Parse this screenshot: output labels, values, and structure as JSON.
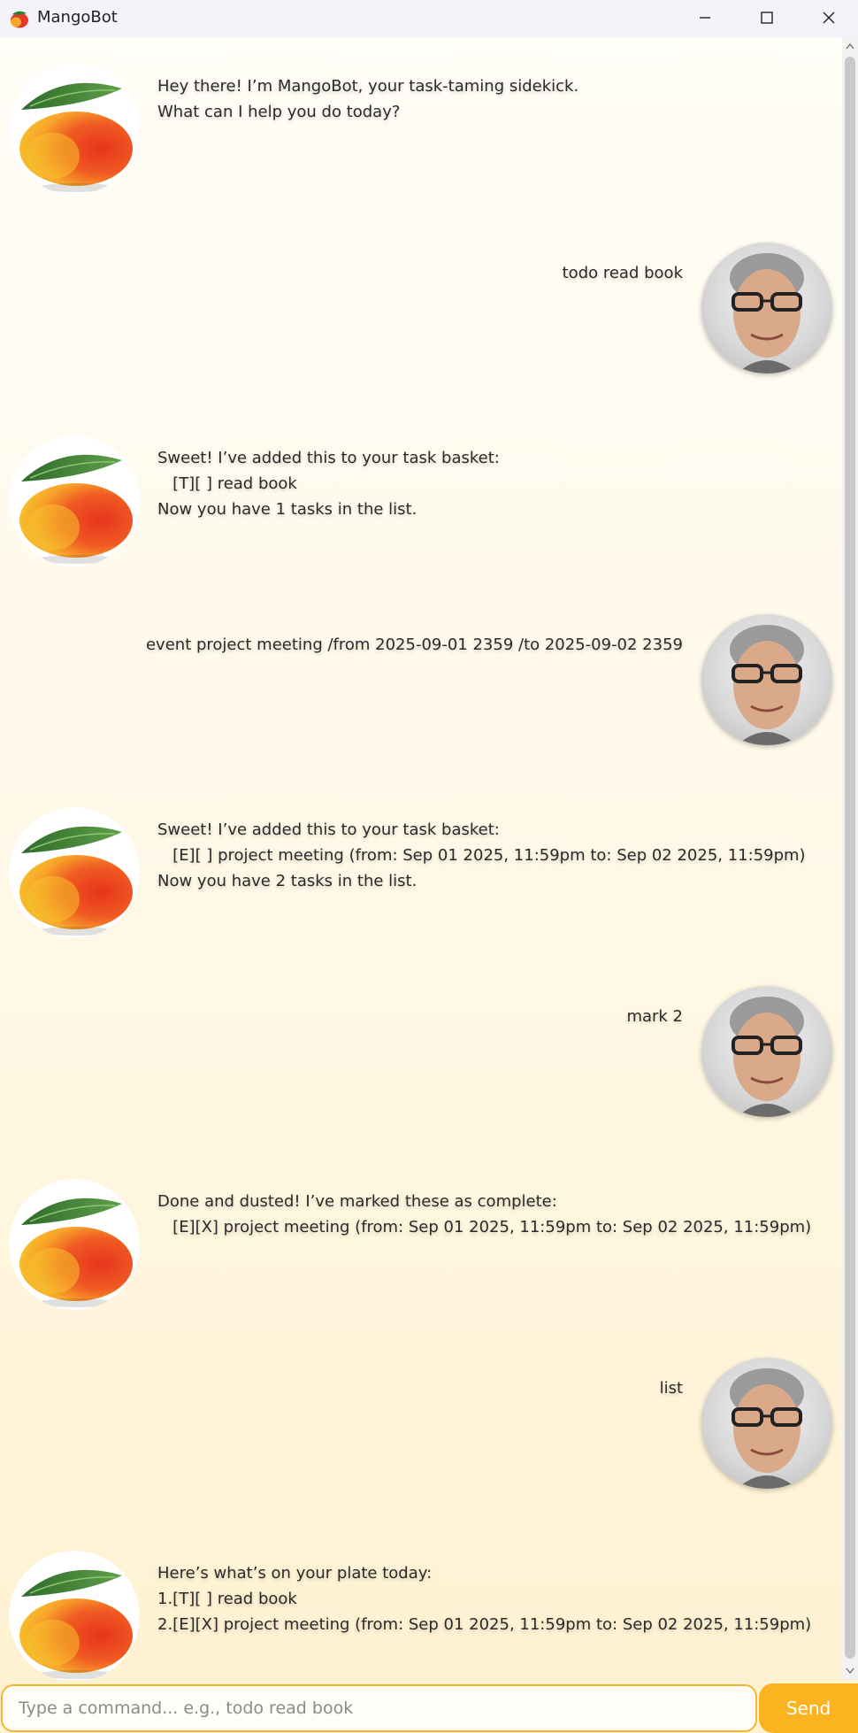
{
  "window": {
    "title": "MangoBot"
  },
  "messages": [
    {
      "sender": "bot",
      "lines": [
        "Hey there! I’m MangoBot, your task-taming sidekick.",
        "What can I help you do today?"
      ]
    },
    {
      "sender": "user",
      "lines": [
        "todo read book"
      ]
    },
    {
      "sender": "bot",
      "lines": [
        "Sweet! I’ve added this to your task basket:",
        "   [T][ ] read book",
        "Now you have 1 tasks in the list."
      ]
    },
    {
      "sender": "user",
      "lines": [
        "event project meeting /from 2025-09-01 2359 /to 2025-09-02 2359"
      ]
    },
    {
      "sender": "bot",
      "lines": [
        "Sweet! I’ve added this to your task basket:",
        "   [E][ ] project meeting (from: Sep 01 2025, 11:59pm to: Sep 02 2025, 11:59pm)",
        "Now you have 2 tasks in the list."
      ]
    },
    {
      "sender": "user",
      "lines": [
        "mark 2"
      ]
    },
    {
      "sender": "bot",
      "lines": [
        "Done and dusted! I’ve marked these as complete:",
        "   [E][X] project meeting (from: Sep 01 2025, 11:59pm to: Sep 02 2025, 11:59pm)"
      ]
    },
    {
      "sender": "user",
      "lines": [
        "list"
      ]
    },
    {
      "sender": "bot",
      "lines": [
        "Here’s what’s on your plate today:",
        "1.[T][ ] read book",
        "2.[E][X] project meeting (from: Sep 01 2025, 11:59pm to: Sep 02 2025, 11:59pm)"
      ]
    }
  ],
  "input": {
    "placeholder": "Type a command... e.g., todo read book",
    "value": ""
  },
  "send_button": {
    "label": "Send"
  },
  "colors": {
    "accent": "#fbb31f",
    "input_border": "#f5b533",
    "titlebar": "#f3f4f9"
  }
}
